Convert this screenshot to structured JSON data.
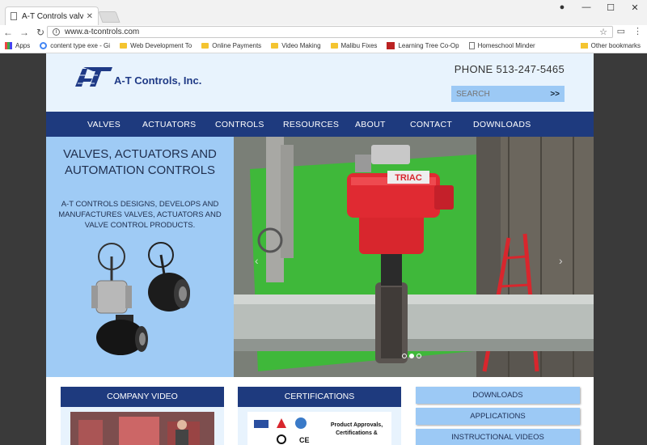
{
  "browser": {
    "tab_title": "A-T Controls valves, actu",
    "url": "www.a-tcontrols.com",
    "bookmarks": [
      {
        "label": "Apps",
        "icon": "apps-icon"
      },
      {
        "label": "content type exe - Gi",
        "icon": "google-icon"
      },
      {
        "label": "Web Development To",
        "icon": "folder-icon"
      },
      {
        "label": "Online Payments",
        "icon": "folder-icon"
      },
      {
        "label": "Video Making",
        "icon": "folder-icon"
      },
      {
        "label": "Malibu Fixes",
        "icon": "folder-icon"
      },
      {
        "label": "Learning Tree Co-Op",
        "icon": "site-icon"
      },
      {
        "label": "Homeschool Minder",
        "icon": "page-icon"
      }
    ],
    "other_bookmarks": "Other bookmarks"
  },
  "header": {
    "logo_text": "A-T Controls, Inc.",
    "phone": "PHONE 513-247-5465",
    "search_placeholder": "SEARCH",
    "search_go": ">>"
  },
  "nav": [
    "VALVES",
    "ACTUATORS",
    "CONTROLS",
    "RESOURCES",
    "ABOUT",
    "CONTACT",
    "DOWNLOADS"
  ],
  "hero": {
    "title_line1": "VALVES, ACTUATORS AND",
    "title_line2": "AUTOMATION CONTROLS",
    "description": "A-T CONTROLS DESIGNS, DEVELOPS AND MANUFACTURES VALVES, ACTUATORS AND VALVE CONTROL PRODUCTS.",
    "actuator_brand": "TRIAC",
    "prev_arrow": "‹",
    "next_arrow": "›",
    "slides": 3,
    "active_slide": 2
  },
  "sections": {
    "video_title": "COMPANY VIDEO",
    "cert_title": "CERTIFICATIONS",
    "cert_text_line1": "Product Approvals,",
    "cert_text_line2": "Certifications &"
  },
  "quick_links": [
    "DOWNLOADS",
    "APPLICATIONS",
    "INSTRUCTIONAL VIDEOS"
  ],
  "colors": {
    "navy": "#1e3a7e",
    "light_blue": "#9fcbf5",
    "header_bg": "#e8f3fd",
    "actuator_red": "#d8262d"
  }
}
